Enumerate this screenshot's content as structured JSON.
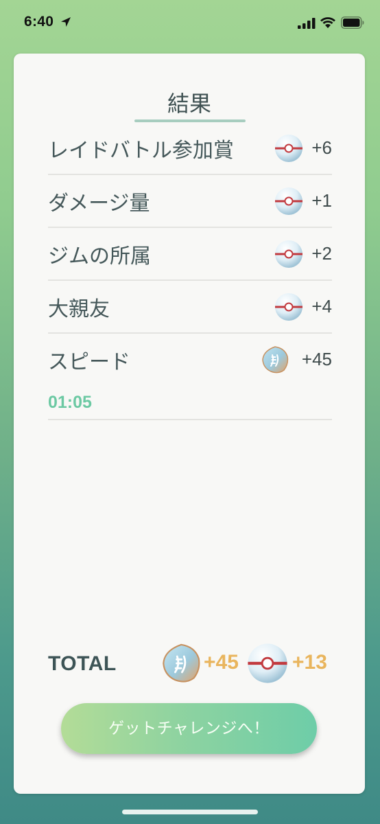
{
  "status_bar": {
    "time": "6:40"
  },
  "colors": {
    "accent_green": "#6cc9a3",
    "total_value": "#e9b55d",
    "label": "#45585a"
  },
  "results": {
    "title": "結果",
    "rows": [
      {
        "label": "レイドバトル参加賞",
        "icon": "premier-ball-icon",
        "value": "+6"
      },
      {
        "label": "ダメージ量",
        "icon": "premier-ball-icon",
        "value": "+1"
      },
      {
        "label": "ジムの所属",
        "icon": "premier-ball-icon",
        "value": "+2"
      },
      {
        "label": "大親友",
        "icon": "premier-ball-icon",
        "value": "+4"
      },
      {
        "label": "スピード",
        "sub": "01:05",
        "icon": "rare-candy-icon",
        "value": "+45"
      }
    ],
    "total": {
      "label": "TOTAL",
      "candy_value": "+45",
      "ball_value": "+13"
    },
    "cta_label": "ゲットチャレンジへ！"
  }
}
